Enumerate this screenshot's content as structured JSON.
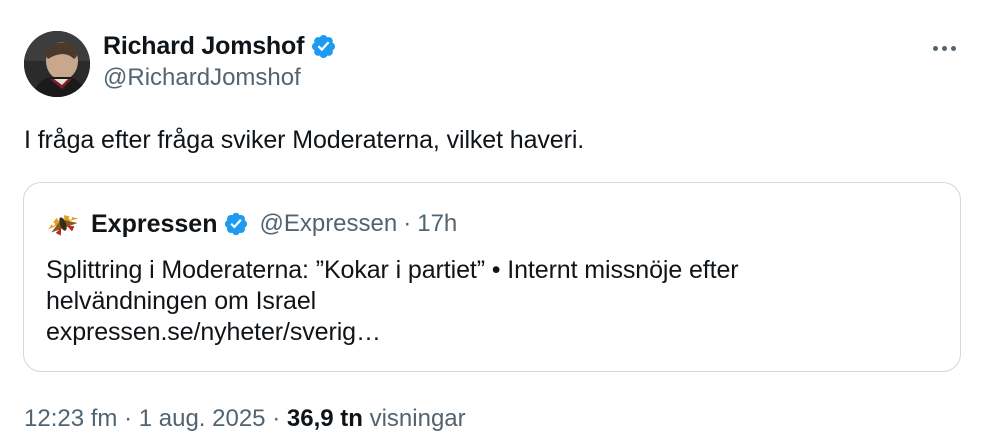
{
  "author": {
    "display_name": "Richard Jomshof",
    "handle": "@RichardJomshof",
    "verified": true
  },
  "tweet_text": "I fråga efter fråga sviker Moderaterna, vilket haveri.",
  "quoted": {
    "name": "Expressen",
    "handle": "@Expressen",
    "dot": "·",
    "time": "17h",
    "verified": true,
    "text_lines": [
      "Splittring i Moderaterna: ”Kokar i partiet” • Internt missnöje efter",
      "helvändningen om Israel",
      "expressen.se/nyheter/sverig…"
    ]
  },
  "meta": {
    "time": "12:23 fm",
    "sep1": "·",
    "date": "1 aug. 2025",
    "sep2": "·",
    "views_count": "36,9 tn",
    "views_label": "visningar"
  },
  "icons": {
    "verified": "verified-badge-icon",
    "more": "more-options-icon",
    "brand_logo": "expressen-logo-icon"
  },
  "colors": {
    "verified_blue": "#1d9bf0",
    "secondary_text": "#536471",
    "primary_text": "#0f1419",
    "border": "#cfd9de"
  }
}
